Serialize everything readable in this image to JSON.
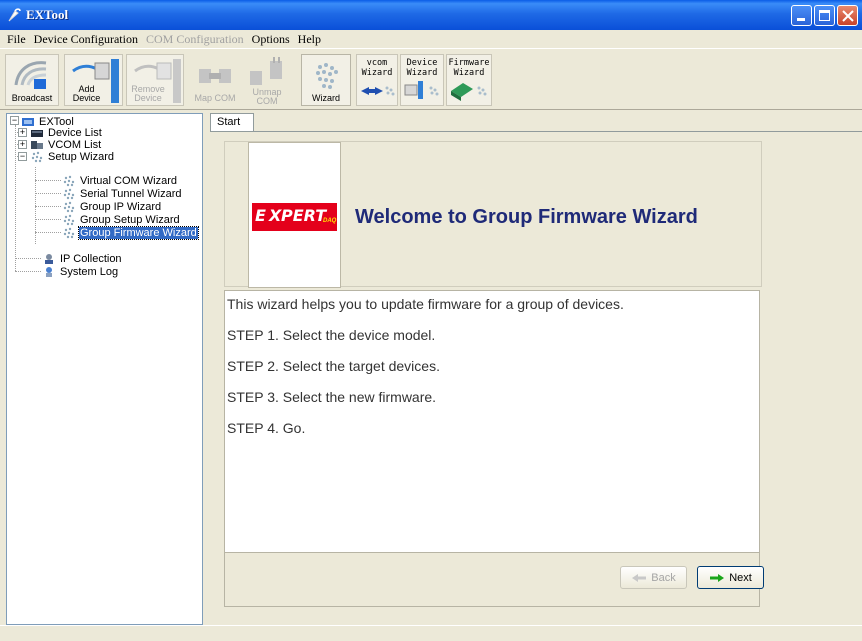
{
  "window": {
    "title": "EXTool"
  },
  "menu": [
    {
      "label": "File",
      "disabled": false
    },
    {
      "label": "Device Configuration",
      "disabled": false
    },
    {
      "label": "COM Configuration",
      "disabled": true
    },
    {
      "label": "Options",
      "disabled": false
    },
    {
      "label": "Help",
      "disabled": false
    }
  ],
  "toolbar": {
    "broadcast": "Broadcast",
    "add_device": "Add Device",
    "remove_device": "Remove Device",
    "map_com": "Map COM",
    "unmap_com": "Unmap COM",
    "wizard": "Wizard",
    "vcom_wizard": "vcom Wizard",
    "device_wizard": "Device Wizard",
    "firmware_wizard": "Firmware Wizard"
  },
  "tree": {
    "root": "EXTool",
    "device_list": "Device List",
    "vcom_list": "VCOM List",
    "setup_wizard": "Setup Wizard",
    "virtual_com_wizard": "Virtual COM Wizard",
    "serial_tunnel_wizard": "Serial Tunnel Wizard",
    "group_ip_wizard": "Group IP Wizard",
    "group_setup_wizard": "Group Setup Wizard",
    "group_firmware_wizard": "Group Firmware Wizard",
    "ip_collection": "IP Collection",
    "system_log": "System Log"
  },
  "tabs": {
    "start": "Start"
  },
  "wizard": {
    "logo": {
      "e": "E",
      "x": "X",
      "pert": "PERT",
      "daq": "DAQ"
    },
    "title": "Welcome to Group Firmware Wizard",
    "intro": "This wizard helps you to update firmware for a group of devices.",
    "step1": "STEP 1. Select the device model.",
    "step2": "STEP 2. Select the target devices.",
    "step3": "STEP 3. Select the new firmware.",
    "step4": "STEP 4. Go.",
    "back": "Back",
    "next": "Next"
  },
  "colors": {
    "titlebar": "#0a4fd8",
    "selection": "#316ac5",
    "welcome_title": "#1f2a78",
    "logo_red": "#e4001b",
    "next_arrow": "#1aa51a"
  }
}
